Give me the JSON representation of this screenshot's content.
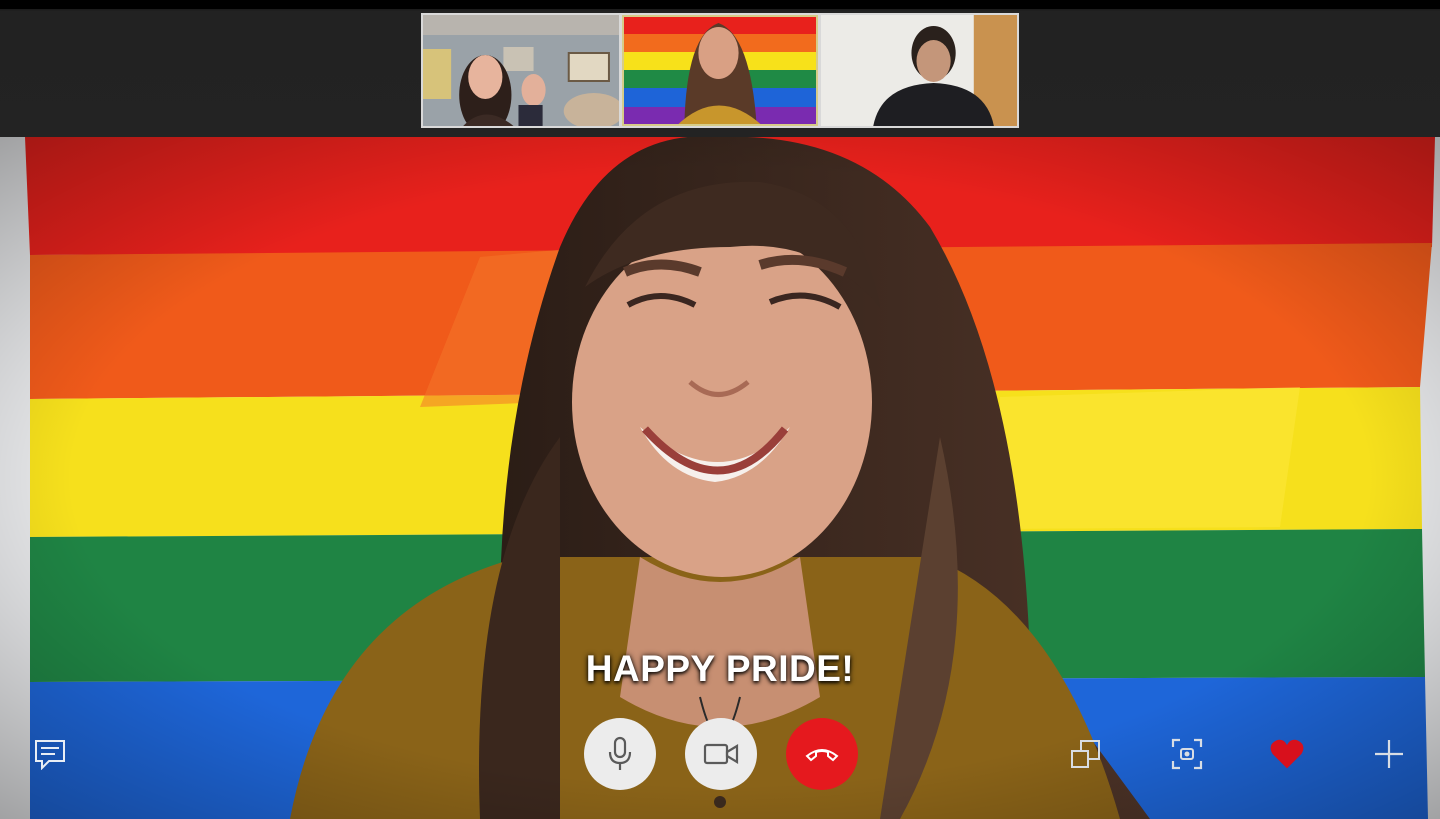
{
  "call": {
    "caption": "HAPPY PRIDE!"
  },
  "participants": [
    {
      "icon": "participant-video-thumbnail",
      "active": false
    },
    {
      "icon": "participant-video-thumbnail",
      "active": true
    },
    {
      "icon": "participant-video-thumbnail",
      "active": false
    }
  ],
  "controls": {
    "chat": {
      "icon": "chat-icon"
    },
    "mute": {
      "icon": "microphone-icon"
    },
    "video": {
      "icon": "video-camera-icon"
    },
    "end_call": {
      "icon": "hang-up-icon"
    },
    "switch_view": {
      "icon": "switch-window-icon"
    },
    "snapshot": {
      "icon": "snapshot-icon"
    },
    "react": {
      "icon": "heart-icon"
    },
    "more": {
      "icon": "plus-icon"
    }
  },
  "colors": {
    "end_call": "#e5191e",
    "heart": "#d8101c",
    "flag": [
      "#e8211c",
      "#f26b1d",
      "#f7e11a",
      "#1f8a45",
      "#1e64d8",
      "#7a2bb0"
    ]
  }
}
